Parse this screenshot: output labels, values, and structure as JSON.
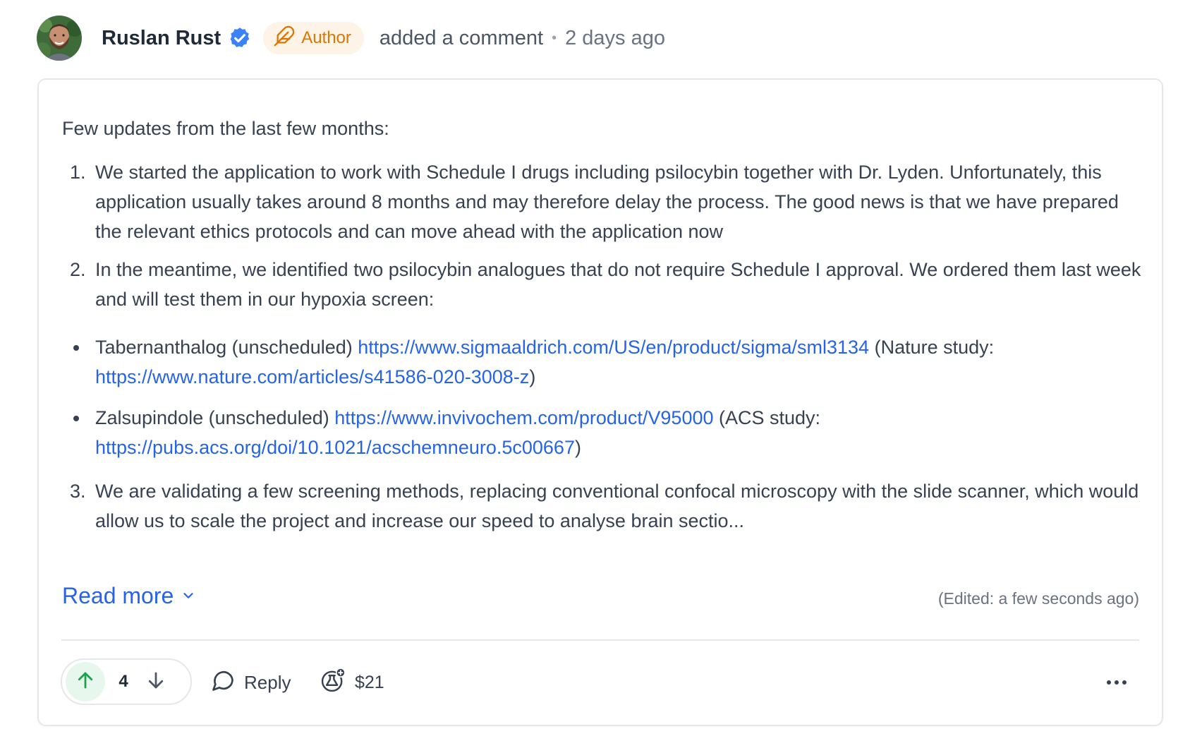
{
  "header": {
    "author_name": "Ruslan Rust",
    "author_badge": "Author",
    "action": "added a comment",
    "separator": "•",
    "timestamp": "2 days ago",
    "verified_color": "#3b82f6",
    "badge_color": "#d97706"
  },
  "comment": {
    "intro": "Few updates from the last few months:",
    "item1_num": "1.",
    "item1_text": "We started the application to work with Schedule I drugs including psilocybin together with Dr. Lyden. Unfortunately, this application usually takes around 8 months and may therefore delay the process. The good news is that we have prepared the relevant ethics protocols and can move ahead with the application now",
    "item2_num": "2.",
    "item2_text": "In the meantime, we identified two psilocybin analogues that do not require Schedule I approval. We ordered them last week and will test them in our hypoxia screen:",
    "bullets": [
      {
        "name": "Tabernanthalog (unscheduled)",
        "product_url": "https://www.sigmaaldrich.com/US/en/product/sigma/sml3134",
        "study_prefix": "(Nature study:",
        "study_url": "https://www.nature.com/articles/s41586-020-3008-z",
        "study_suffix": ")"
      },
      {
        "name": "Zalsupindole (unscheduled)",
        "product_url": "https://www.invivochem.com/product/V95000",
        "study_prefix": "(ACS study:",
        "study_url": "https://pubs.acs.org/doi/10.1021/acschemneuro.5c00667",
        "study_suffix": ")"
      }
    ],
    "item3_num": "3.",
    "item3_text": "We are validating a few screening methods, replacing conventional confocal microscopy with the slide scanner, which would allow us to scale the project and increase our speed to analyse brain sectio...",
    "read_more": "Read more",
    "edited": "(Edited: a few seconds ago)",
    "link_color": "#2563eb"
  },
  "footer": {
    "vote_count": "4",
    "reply_label": "Reply",
    "tip_amount": "$21",
    "upvote_color": "#16a34a",
    "icons": {
      "upvote": "arrow-up-icon",
      "downvote": "arrow-down-icon",
      "reply": "speech-bubble-icon",
      "tip": "flask-plus-icon",
      "more": "ellipsis-icon"
    }
  }
}
